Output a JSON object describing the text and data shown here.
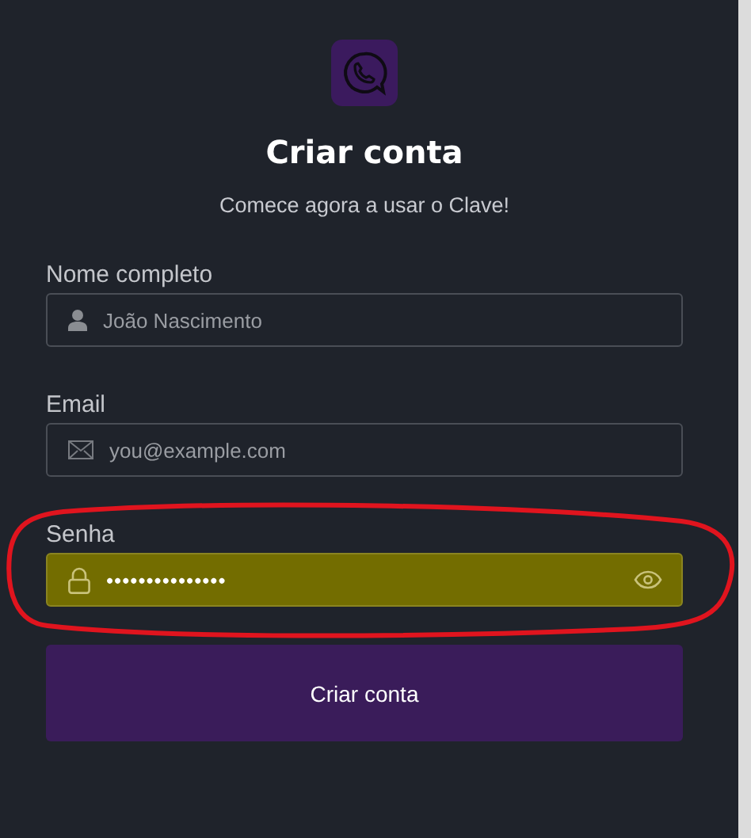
{
  "header": {
    "title": "Criar conta",
    "subtitle": "Comece agora a usar o Clave!"
  },
  "fields": [
    {
      "kind": "name",
      "label": "Nome completo",
      "placeholder": "João Nascimento",
      "autofilled": false
    },
    {
      "kind": "email",
      "label": "Email",
      "placeholder": "you@example.com",
      "autofilled": false
    },
    {
      "kind": "password",
      "label": "Senha",
      "value": "•••••••••••••••",
      "autofilled": true,
      "annotated": true
    }
  ],
  "submit": {
    "label": "Criar conta"
  }
}
